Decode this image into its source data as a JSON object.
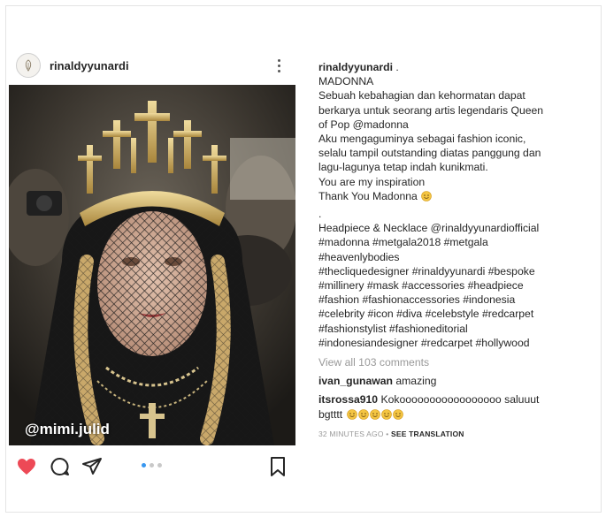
{
  "post": {
    "username": "rinaldyyunardi",
    "watermark": "@mimi.julid",
    "liked": true
  },
  "caption": {
    "username": "rinaldyyunardi",
    "username_suffix": " .",
    "title": "MADONNA",
    "para1_lines": [
      "Sebuah kebahagian dan kehormatan dapat",
      "berkarya untuk seorang artis legendaris Queen",
      "of Pop @madonna"
    ],
    "para2_lines": [
      "Aku mengaguminya sebagai fashion iconic,",
      "selalu tampil outstanding diatas panggung dan",
      "lagu-lagunya tetap indah kunikmati."
    ],
    "inspiration": "You are my inspiration",
    "thanks": "Thank You Madonna",
    "dot": ".",
    "tag_lines": [
      "Headpiece & Necklace @rinaldyyunardiofficial",
      "#madonna #metgala2018 #metgala",
      "#heavenlybodies",
      "#thecliquedesigner #rinaldyyunardi #bespoke",
      "#millinery #mask #accessories #headpiece",
      "#fashion #fashionaccessories #indonesia",
      "#celebrity #icon #diva #celebstyle #redcarpet",
      "#fashionstylist #fashioneditorial",
      "#indonesiandesigner #redcarpet #hollywood"
    ]
  },
  "comments": {
    "view_all": "View all 103 comments",
    "items": [
      {
        "user": "ivan_gunawan",
        "text": "amazing"
      },
      {
        "user": "itsrossa910",
        "text": "Kokooooooooooooooooo saluuut",
        "text2": "bgtttt",
        "emoji_count": 5
      }
    ]
  },
  "footer": {
    "time": "32 MINUTES AGO",
    "separator": " • ",
    "translate": "SEE TRANSLATION"
  },
  "colors": {
    "like": "#ed4956",
    "dot_active": "#3897f0",
    "muted": "#999999"
  },
  "icons": [
    "more-icon",
    "heart-icon",
    "comment-icon",
    "share-icon",
    "bookmark-icon",
    "emoji-smile-icon"
  ]
}
